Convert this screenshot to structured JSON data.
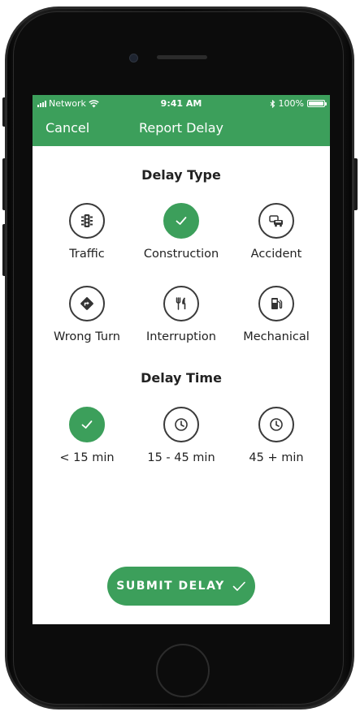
{
  "status_bar": {
    "carrier": "Network",
    "time": "9:41 AM",
    "battery": "100%"
  },
  "nav": {
    "cancel_label": "Cancel",
    "title": "Report Delay"
  },
  "delay_type": {
    "title": "Delay Type",
    "options": [
      {
        "label": "Traffic",
        "icon": "traffic-light-icon",
        "selected": false
      },
      {
        "label": "Construction",
        "icon": "checkmark-icon",
        "selected": true
      },
      {
        "label": "Accident",
        "icon": "car-collision-icon",
        "selected": false
      },
      {
        "label": "Wrong Turn",
        "icon": "turn-sign-icon",
        "selected": false
      },
      {
        "label": "Interruption",
        "icon": "fork-knife-icon",
        "selected": false
      },
      {
        "label": "Mechanical",
        "icon": "fuel-pump-icon",
        "selected": false
      }
    ]
  },
  "delay_time": {
    "title": "Delay Time",
    "options": [
      {
        "label": "< 15 min",
        "icon": "checkmark-icon",
        "selected": true
      },
      {
        "label": "15 - 45 min",
        "icon": "clock-icon",
        "selected": false
      },
      {
        "label": "45 + min",
        "icon": "clock-icon",
        "selected": false
      }
    ]
  },
  "submit": {
    "label": "SUBMIT DELAY"
  },
  "colors": {
    "accent": "#3c9f5b",
    "text": "#222222",
    "outline": "#3a3a3a"
  }
}
